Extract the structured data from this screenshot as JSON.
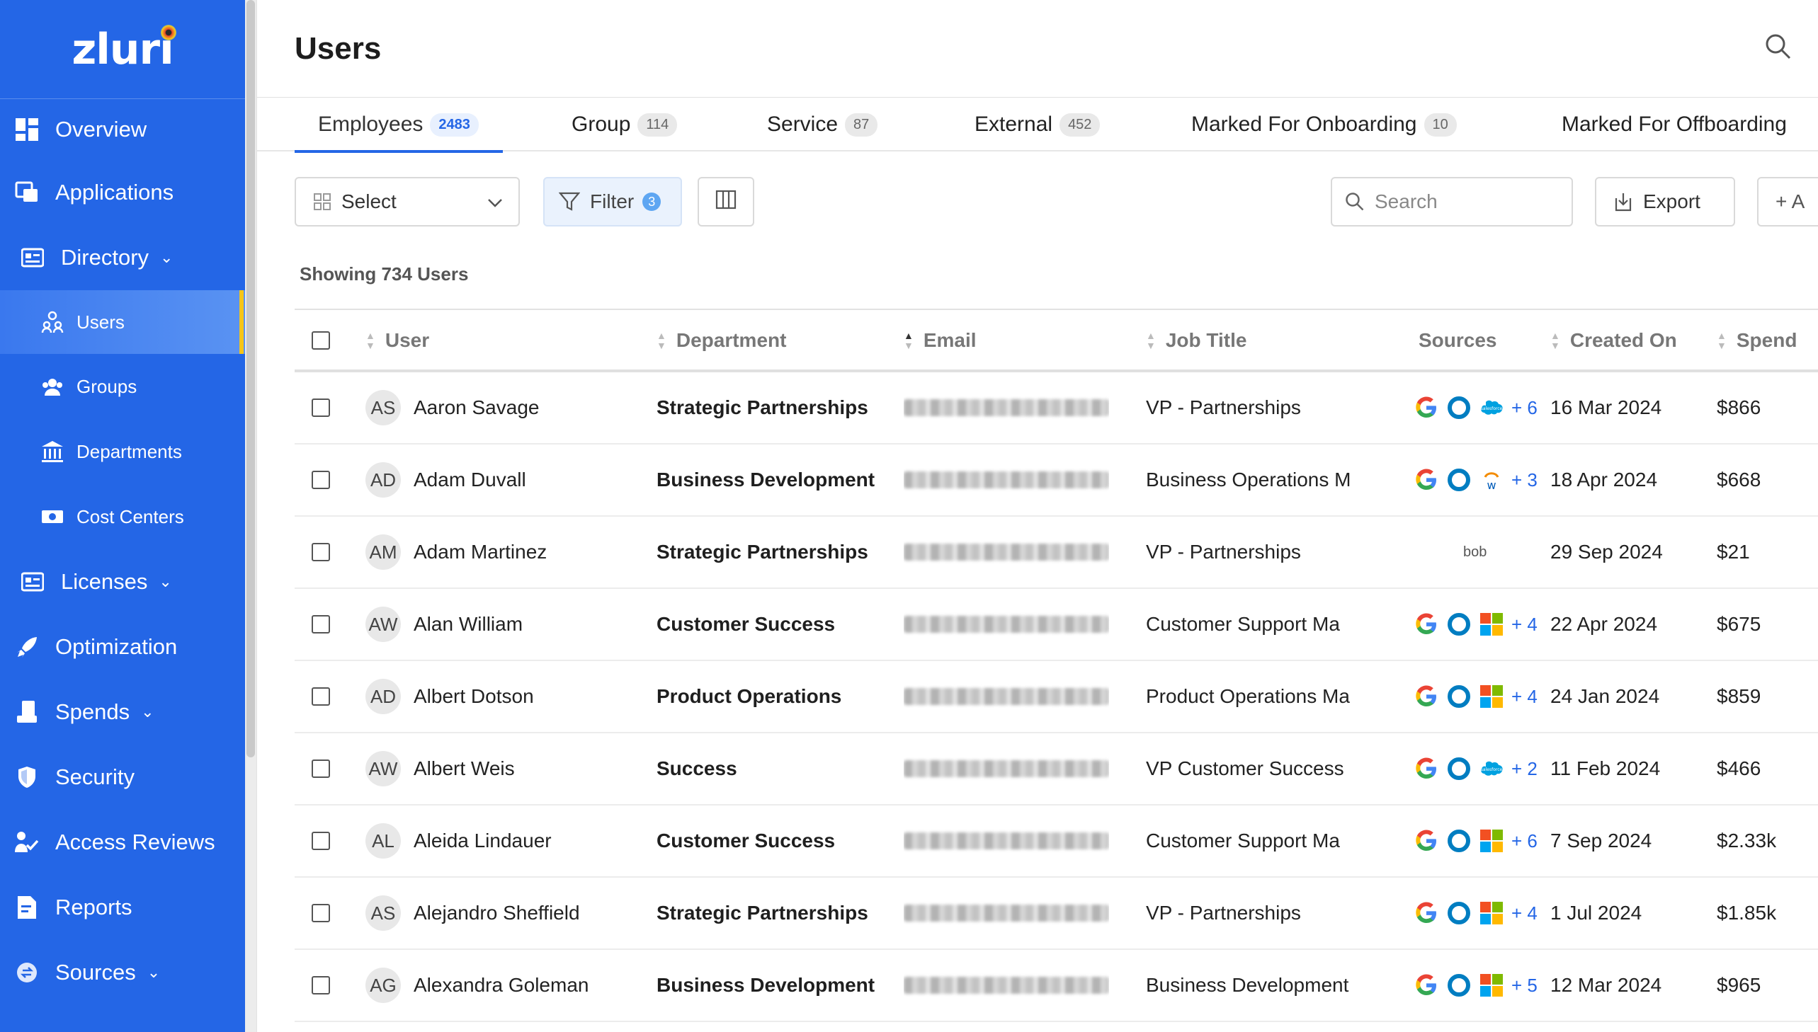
{
  "brand": {
    "logo_text": "zluri",
    "accent": "#2466e6",
    "active_marker": "#f5c518"
  },
  "sidebar": {
    "items": [
      {
        "label": "Overview",
        "icon": "grid-icon"
      },
      {
        "label": "Applications",
        "icon": "applications-icon"
      },
      {
        "label": "Directory",
        "icon": "directory-icon",
        "expandable": true
      },
      {
        "label": "Users",
        "icon": "users-icon",
        "sub": true,
        "active": true
      },
      {
        "label": "Groups",
        "icon": "groups-icon",
        "sub": true
      },
      {
        "label": "Departments",
        "icon": "building-icon",
        "sub": true
      },
      {
        "label": "Cost Centers",
        "icon": "money-icon",
        "sub": true
      },
      {
        "label": "Licenses",
        "icon": "licenses-icon",
        "expandable": true
      },
      {
        "label": "Optimization",
        "icon": "rocket-icon"
      },
      {
        "label": "Spends",
        "icon": "spends-icon",
        "expandable": true
      },
      {
        "label": "Security",
        "icon": "shield-icon"
      },
      {
        "label": "Access Reviews",
        "icon": "access-review-icon"
      },
      {
        "label": "Reports",
        "icon": "reports-icon"
      },
      {
        "label": "Sources",
        "icon": "sources-icon",
        "expandable": true
      }
    ]
  },
  "header": {
    "title": "Users"
  },
  "tabs": [
    {
      "label": "Employees",
      "count": "2483",
      "active": true
    },
    {
      "label": "Group",
      "count": "114"
    },
    {
      "label": "Service",
      "count": "87"
    },
    {
      "label": "External",
      "count": "452"
    },
    {
      "label": "Marked For Onboarding",
      "count": "10"
    },
    {
      "label": "Marked For Offboarding",
      "count": ""
    }
  ],
  "toolbar": {
    "select_label": "Select",
    "filter_label": "Filter",
    "filter_count": "3",
    "search_placeholder": "Search",
    "export_label": "Export",
    "add_label": "+ A"
  },
  "summary": {
    "showing": "Showing 734 Users"
  },
  "table": {
    "columns": [
      "User",
      "Department",
      "Email",
      "Job Title",
      "Sources",
      "Created On",
      "Spend"
    ],
    "rows": [
      {
        "initials": "AS",
        "name": "Aaron Savage",
        "department": "Strategic Partnerships",
        "job_title": "VP - Partnerships",
        "sources": [
          "google",
          "okta",
          "salesforce"
        ],
        "more": "+ 6",
        "created": "16 Mar 2024",
        "spend": "$866"
      },
      {
        "initials": "AD",
        "name": "Adam Duvall",
        "department": "Business Development",
        "job_title": "Business Operations M",
        "sources": [
          "google",
          "okta",
          "workday"
        ],
        "more": "+ 3",
        "created": "18 Apr 2024",
        "spend": "$668"
      },
      {
        "initials": "AM",
        "name": "Adam Martinez",
        "department": "Strategic Partnerships",
        "job_title": "VP - Partnerships",
        "sources": [
          "bob"
        ],
        "more": "",
        "created": "29 Sep 2024",
        "spend": "$21"
      },
      {
        "initials": "AW",
        "name": "Alan William",
        "department": "Customer Success",
        "job_title": "Customer Support Ma",
        "sources": [
          "google",
          "okta",
          "microsoft"
        ],
        "more": "+ 4",
        "created": "22 Apr 2024",
        "spend": "$675"
      },
      {
        "initials": "AD",
        "name": "Albert Dotson",
        "department": "Product Operations",
        "job_title": "Product Operations Ma",
        "sources": [
          "google",
          "okta",
          "microsoft"
        ],
        "more": "+ 4",
        "created": "24 Jan 2024",
        "spend": "$859"
      },
      {
        "initials": "AW",
        "name": "Albert Weis",
        "department": "Success",
        "job_title": "VP Customer Success",
        "sources": [
          "google",
          "okta",
          "salesforce"
        ],
        "more": "+ 2",
        "created": "11 Feb 2024",
        "spend": "$466"
      },
      {
        "initials": "AL",
        "name": "Aleida Lindauer",
        "department": "Customer Success",
        "job_title": "Customer Support Ma",
        "sources": [
          "google",
          "okta",
          "microsoft"
        ],
        "more": "+ 6",
        "created": "7 Sep 2024",
        "spend": "$2.33k"
      },
      {
        "initials": "AS",
        "name": "Alejandro Sheffield",
        "department": "Strategic Partnerships",
        "job_title": "VP - Partnerships",
        "sources": [
          "google",
          "okta",
          "microsoft"
        ],
        "more": "+ 4",
        "created": "1 Jul 2024",
        "spend": "$1.85k"
      },
      {
        "initials": "AG",
        "name": "Alexandra Goleman",
        "department": "Business Development",
        "job_title": "Business Development",
        "sources": [
          "google",
          "okta",
          "microsoft"
        ],
        "more": "+ 5",
        "created": "12 Mar 2024",
        "spend": "$965"
      }
    ]
  }
}
